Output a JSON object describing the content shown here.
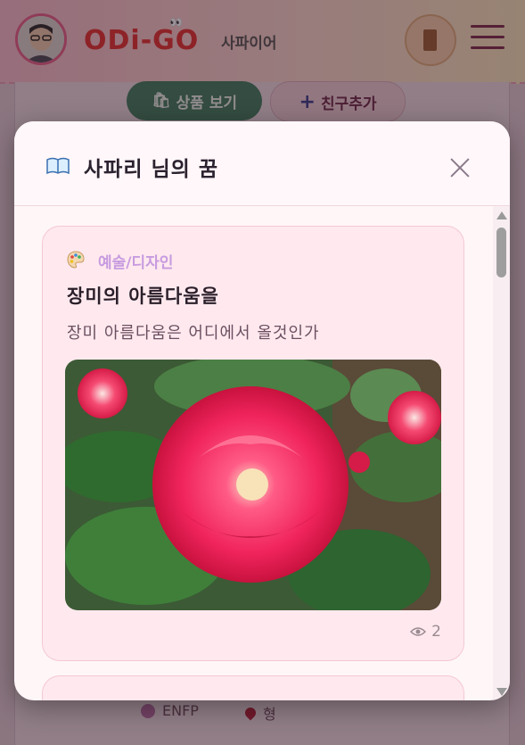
{
  "header": {
    "logo_text": "ODi-GO",
    "nickname": "사파이어",
    "door_icon": "door-icon",
    "menu_icon": "hamburger-menu-icon"
  },
  "actions": {
    "shop_label": "상품 보기",
    "friend_label": "친구추가"
  },
  "profile_info": {
    "mbti": "ENFP",
    "blood": "형"
  },
  "modal": {
    "title": "사파리 님의 꿈",
    "title_icon": "book-icon",
    "close_icon": "close-icon"
  },
  "dream_card": {
    "category_icon": "palette-icon",
    "category": "예술/디자인",
    "title": "장미의 아름다움을",
    "subtitle": "장미 아름다움은 어디에서 올것인가",
    "image_alt": "red rose photo",
    "views": "2",
    "views_icon": "eye-icon"
  },
  "colors": {
    "modal_bg": "#fff6f8",
    "card_bg": "#ffe9ee",
    "category_color": "#c79be0",
    "accent_pink": "#e35d87",
    "shop_green": "#3f7a5e"
  }
}
